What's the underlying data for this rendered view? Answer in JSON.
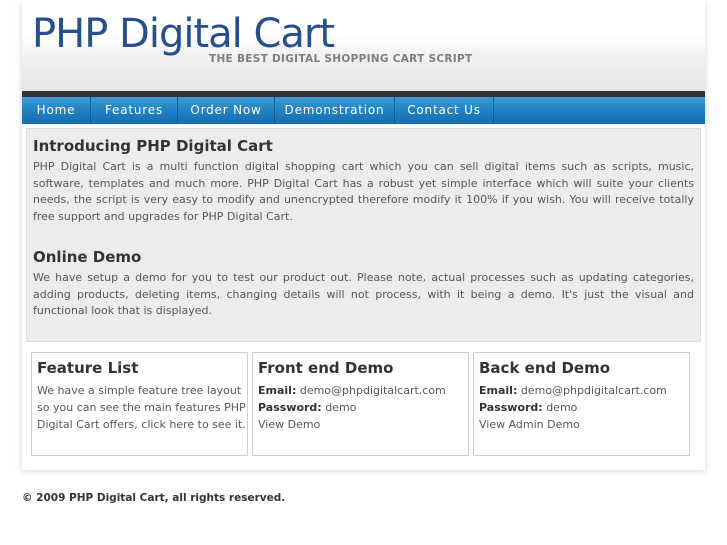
{
  "header": {
    "logo_text": "PHP Digital Cart",
    "tagline": "THE BEST DIGITAL SHOPPING CART SCRIPT"
  },
  "nav": {
    "items": [
      "Home",
      "Features",
      "Order Now",
      "Demonstration",
      "Contact Us"
    ]
  },
  "intro": {
    "title": "Introducing PHP Digital Cart",
    "body": "PHP Digital Cart is a multi function digital shopping cart which you can sell digital items such as scripts, music, software, templates and much more. PHP Digital Cart has a robust yet simple interface which will suite your clients needs, the script is very easy to modify and unencrypted therefore modify it 100% if you wish. You will receive totally free support and upgrades for PHP Digital Cart."
  },
  "demo": {
    "title": "Online Demo",
    "body": "We have setup a demo for you to test our product out. Please note, actual processes such as updating categories, adding products, deleting items, changing details will not process, with it being a demo. It's just the visual and functional look that is displayed."
  },
  "feature_box": {
    "title": "Feature List",
    "lines": [
      "We have a simple feature tree layout",
      "so you can see the main features PHP",
      "Digital Cart offers,"
    ],
    "link": "click here",
    "tail": " to see it."
  },
  "front_box": {
    "title": "Front end Demo",
    "email_label": "Email:",
    "email": " demo@phpdigitalcart.com",
    "password_label": "Password:",
    "password": " demo",
    "link": "View Demo"
  },
  "back_box": {
    "title": "Back end Demo",
    "email_label": "Email:",
    "email": " demo@phpdigitalcart.com",
    "password_label": "Password:",
    "password": " demo",
    "link": "View Admin Demo"
  },
  "footer": {
    "text": "© 2009 PHP Digital Cart, all rights reserved."
  }
}
